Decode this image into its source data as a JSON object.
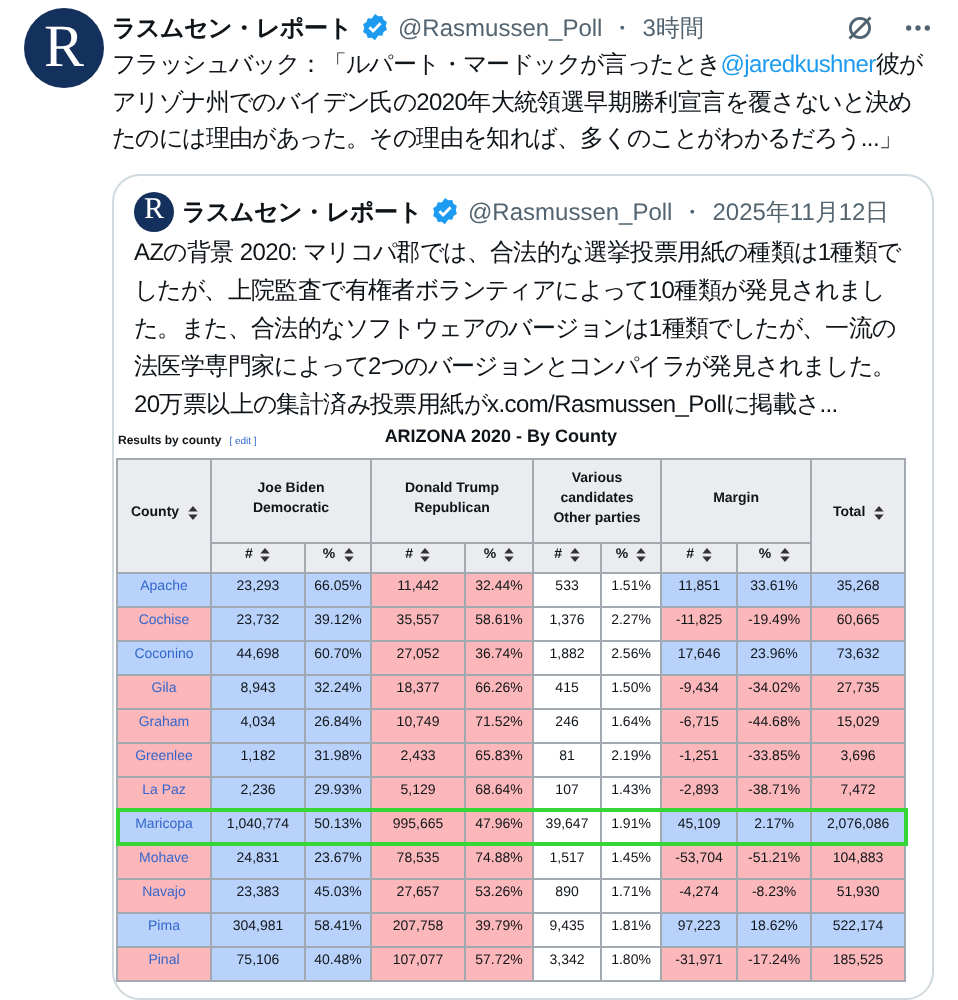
{
  "tweet": {
    "logo_text": "R",
    "name": "ラスムセン・レポート",
    "verified": true,
    "handle": "@Rasmussen_Poll",
    "separator": "・",
    "time": "3時間",
    "text_parts": [
      {
        "kind": "text",
        "text": "フラッシュバック：「ルパート・マードックが言ったとき"
      },
      {
        "kind": "mention",
        "text": "@jaredkushner"
      },
      {
        "kind": "text",
        "text": "彼がアリゾナ州でのバイデン氏の2020年大統領選早期勝利宣言を覆さないと決めたのには理由があった。その理由を知れば、多くのことがわかるだろう...」"
      }
    ]
  },
  "quote": {
    "logo_text": "R",
    "name": "ラスムセン・レポート",
    "verified": true,
    "handle": "@Rasmussen_Poll",
    "separator": "・",
    "date": "2025年11月12日",
    "text": "AZの背景 2020: マリコパ郡では、合法的な選挙投票用紙の種類は1種類でしたが、上院監査で有権者ボランティアによって10種類が発見されました。また、合法的なソフトウェアのバージョンは1種類でしたが、一流の法医学専門家によって2つのバージョンとコンパイラが発見されました。20万票以上の集計済み投票用紙がx.com/Rasmussen_Pollに掲載さ..."
  },
  "table": {
    "section": "Results by county",
    "edit_link": "[ edit ]",
    "title": "ARIZONA 2020 - By County",
    "county_header": "County",
    "total_header": "Total",
    "groups": [
      {
        "lines": [
          "Joe Biden",
          "Democratic"
        ]
      },
      {
        "lines": [
          "Donald Trump",
          "Republican"
        ]
      },
      {
        "lines": [
          "Various",
          "candidates",
          "Other parties"
        ]
      },
      {
        "lines": [
          "Margin"
        ]
      }
    ],
    "subheaders": [
      "#",
      "%",
      "#",
      "%",
      "#",
      "%",
      "#",
      "%"
    ],
    "rows": [
      {
        "county": "Apache",
        "kind": "dem",
        "highlighted": false,
        "cells": [
          "23,293",
          "66.05%",
          "11,442",
          "32.44%",
          "533",
          "1.51%",
          "11,851",
          "33.61%",
          "35,268"
        ]
      },
      {
        "county": "Cochise",
        "kind": "rep",
        "highlighted": false,
        "cells": [
          "23,732",
          "39.12%",
          "35,557",
          "58.61%",
          "1,376",
          "2.27%",
          "-11,825",
          "-19.49%",
          "60,665"
        ]
      },
      {
        "county": "Coconino",
        "kind": "dem",
        "highlighted": false,
        "cells": [
          "44,698",
          "60.70%",
          "27,052",
          "36.74%",
          "1,882",
          "2.56%",
          "17,646",
          "23.96%",
          "73,632"
        ]
      },
      {
        "county": "Gila",
        "kind": "rep",
        "highlighted": false,
        "cells": [
          "8,943",
          "32.24%",
          "18,377",
          "66.26%",
          "415",
          "1.50%",
          "-9,434",
          "-34.02%",
          "27,735"
        ]
      },
      {
        "county": "Graham",
        "kind": "rep",
        "highlighted": false,
        "cells": [
          "4,034",
          "26.84%",
          "10,749",
          "71.52%",
          "246",
          "1.64%",
          "-6,715",
          "-44.68%",
          "15,029"
        ]
      },
      {
        "county": "Greenlee",
        "kind": "rep",
        "highlighted": false,
        "cells": [
          "1,182",
          "31.98%",
          "2,433",
          "65.83%",
          "81",
          "2.19%",
          "-1,251",
          "-33.85%",
          "3,696"
        ]
      },
      {
        "county": "La Paz",
        "kind": "rep",
        "highlighted": false,
        "cells": [
          "2,236",
          "29.93%",
          "5,129",
          "68.64%",
          "107",
          "1.43%",
          "-2,893",
          "-38.71%",
          "7,472"
        ]
      },
      {
        "county": "Maricopa",
        "kind": "dem",
        "highlighted": true,
        "cells": [
          "1,040,774",
          "50.13%",
          "995,665",
          "47.96%",
          "39,647",
          "1.91%",
          "45,109",
          "2.17%",
          "2,076,086"
        ]
      },
      {
        "county": "Mohave",
        "kind": "rep",
        "highlighted": false,
        "cells": [
          "24,831",
          "23.67%",
          "78,535",
          "74.88%",
          "1,517",
          "1.45%",
          "-53,704",
          "-51.21%",
          "104,883"
        ]
      },
      {
        "county": "Navajo",
        "kind": "rep",
        "highlighted": false,
        "cells": [
          "23,383",
          "45.03%",
          "27,657",
          "53.26%",
          "890",
          "1.71%",
          "-4,274",
          "-8.23%",
          "51,930"
        ]
      },
      {
        "county": "Pima",
        "kind": "dem",
        "highlighted": false,
        "cells": [
          "304,981",
          "58.41%",
          "207,758",
          "39.79%",
          "9,435",
          "1.81%",
          "97,223",
          "18.62%",
          "522,174"
        ]
      },
      {
        "county": "Pinal",
        "kind": "rep",
        "highlighted": false,
        "cells": [
          "75,106",
          "40.48%",
          "107,077",
          "57.72%",
          "3,342",
          "1.80%",
          "-31,971",
          "-17.24%",
          "185,525"
        ]
      }
    ]
  }
}
